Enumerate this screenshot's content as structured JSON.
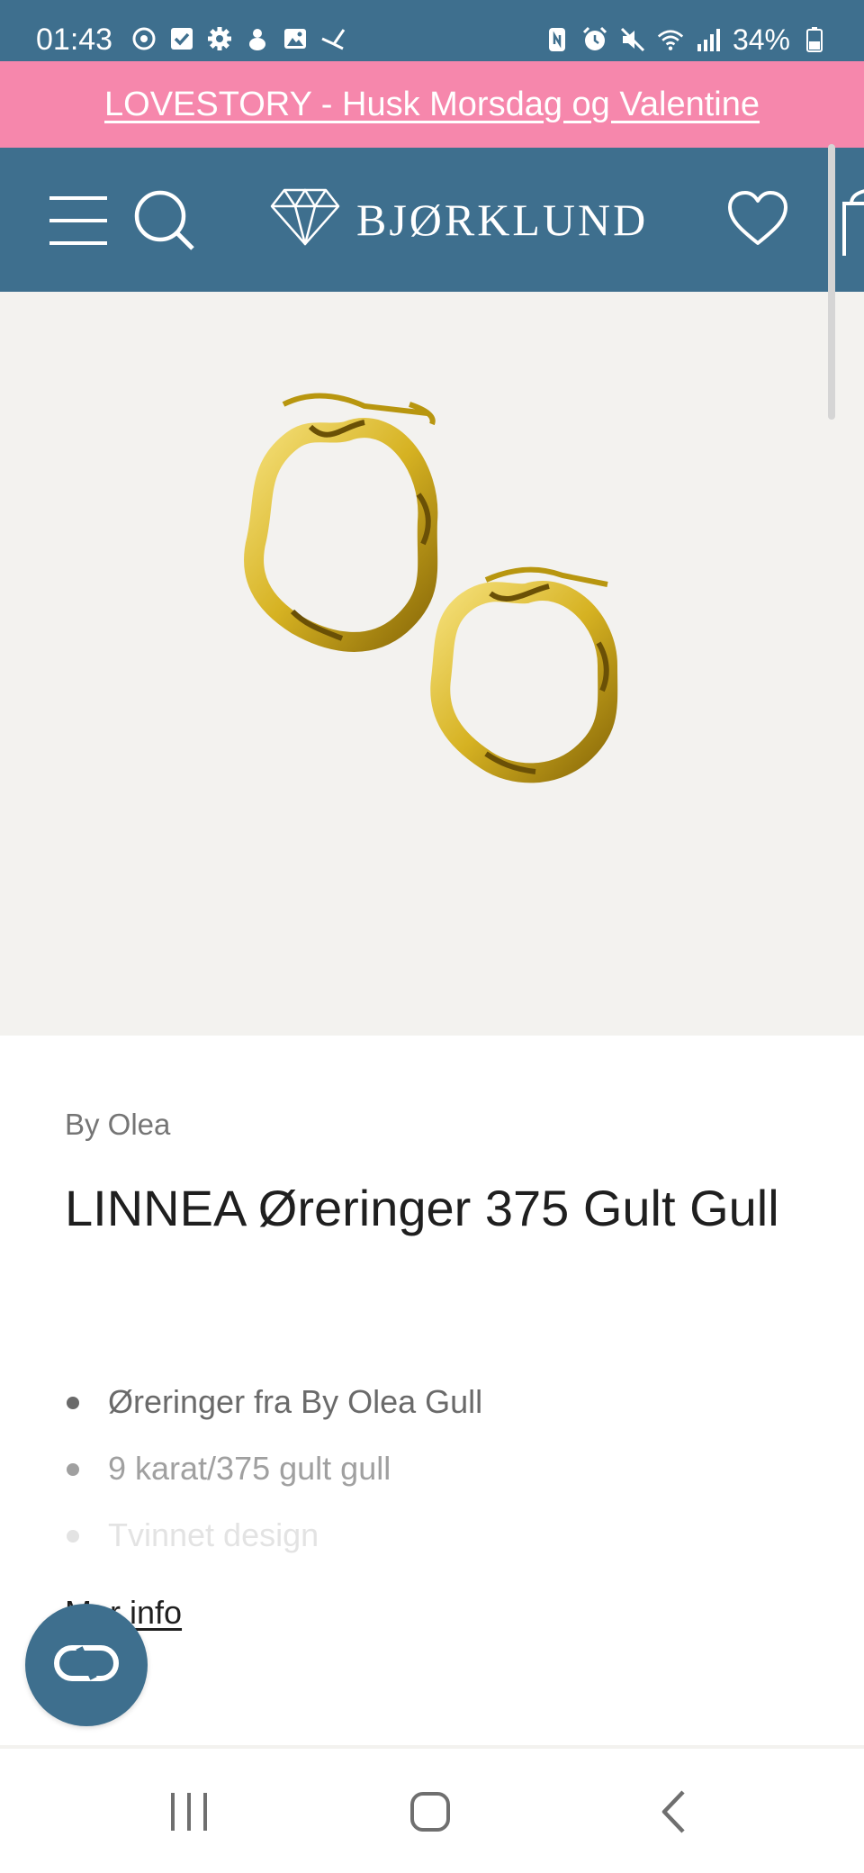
{
  "status_bar": {
    "time": "01:43",
    "battery": "34%",
    "left_icons": [
      "sync-icon",
      "checkbox-icon",
      "settings-icon",
      "cleaner-icon",
      "gallery-icon",
      "bird-icon"
    ],
    "right_icons": [
      "nfc-icon",
      "alarm-icon",
      "mute-icon",
      "wifi-icon",
      "signal-icon",
      "battery-icon"
    ]
  },
  "promo": {
    "text": "LOVESTORY - Husk Morsdag og Valentine"
  },
  "header": {
    "brand": "BJØRKLUND",
    "icons": [
      "menu-icon",
      "search-icon",
      "diamond-logo-icon",
      "heart-icon",
      "bag-icon"
    ]
  },
  "product": {
    "brand_label": "By Olea",
    "title": "LINNEA Øreringer 375 Gult Gull",
    "features": [
      "Øreringer fra By Olea Gull",
      "9 karat/375 gult gull",
      "Tvinnet design"
    ],
    "more_info": "Mer info"
  },
  "chat": {
    "icon": "chat-icon"
  },
  "nav": {
    "icons": [
      "recent-apps-icon",
      "home-icon",
      "back-icon"
    ]
  },
  "colors": {
    "header_bg": "#3e6f8e",
    "promo_bg": "#f687ac",
    "image_bg": "#f3f2ef",
    "gold": "#e2c22e"
  }
}
